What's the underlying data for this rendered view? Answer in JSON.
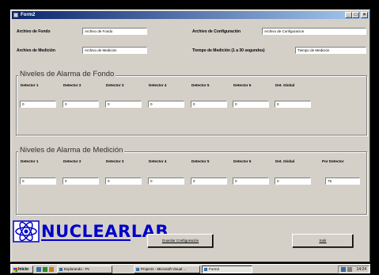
{
  "window": {
    "title": "Form2"
  },
  "top_fields": {
    "archivo_fondo": {
      "label": "Archivo de Fondo",
      "value": "Archivo de Fondo"
    },
    "archivo_config": {
      "label": "Archivo de Configuración",
      "value": "Archivo de Configuracion"
    },
    "archivo_medicion": {
      "label": "Archivo de Medición",
      "value": "Archivo de Medición"
    },
    "tiempo_medicion": {
      "label": "Tiempo de Medición (1 a 30 segundos)",
      "value": "Tiempo de Medición"
    }
  },
  "fondo": {
    "title": "Niveles de Alarma de Fondo",
    "columns": [
      "Detector 1",
      "Detector 2",
      "Detector 3",
      "Detector 4",
      "Detector 5",
      "Detector 6",
      "Det. Global"
    ],
    "values": [
      "0",
      "0",
      "0",
      "0",
      "0",
      "0",
      "0"
    ]
  },
  "medicion": {
    "title": "Niveles de Alarma de Medición",
    "columns": [
      "Detector 1",
      "Detector 2",
      "Detector 3",
      "Detector 4",
      "Detector 5",
      "Detector 6",
      "Det. Global",
      "Por Detector"
    ],
    "values": [
      "0",
      "0",
      "0",
      "0",
      "0",
      "0",
      "0",
      "75"
    ]
  },
  "buttons": {
    "guardar": "Guardar Configuración",
    "salir": "Salir"
  },
  "logo": {
    "text": "NUCLEARLAB"
  },
  "taskbar": {
    "start": "Inicio",
    "tasks": [
      "Explorando - Pc",
      "Project1 - Microsoft Visual ...",
      "Form2"
    ],
    "clock": "14:24"
  },
  "colors": {
    "title_start": "#0a246a",
    "title_end": "#a6caf0",
    "face": "#d4d0c8",
    "logo": "#0000c8"
  },
  "icons": {
    "minimize": "minimize-icon",
    "maximize": "maximize-icon",
    "close": "close-icon",
    "logo": "atom-icon"
  }
}
